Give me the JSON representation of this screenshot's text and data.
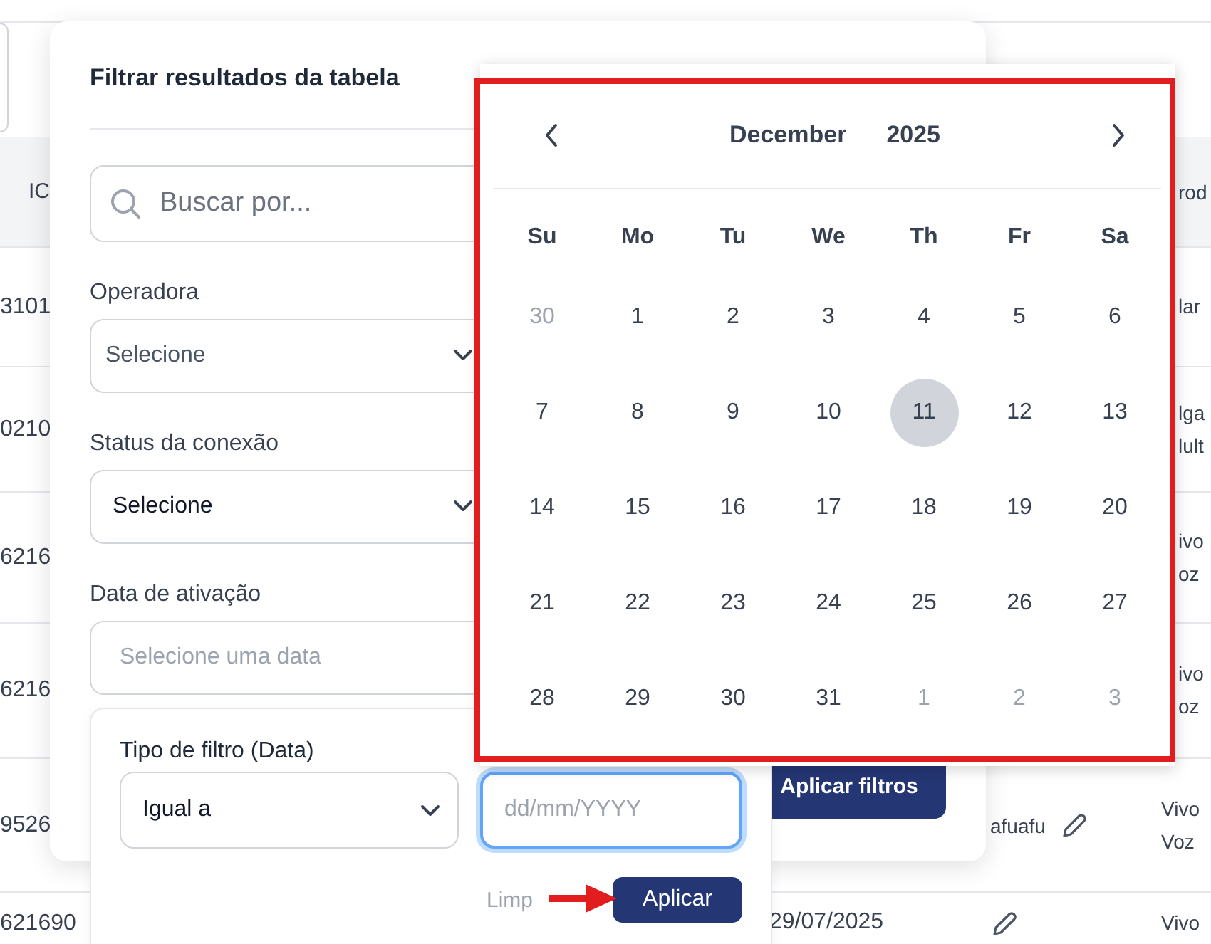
{
  "table": {
    "columns": [
      {
        "label": "IC"
      },
      {
        "label": "rod"
      }
    ],
    "rows": [
      {
        "id": "3101",
        "product": [
          "lar"
        ]
      },
      {
        "id": "0210",
        "product": [
          "lga",
          "lult"
        ]
      },
      {
        "id": "6216",
        "product": [
          "ivo",
          "oz"
        ]
      },
      {
        "id": "6216",
        "product": [
          "ivo",
          "oz"
        ]
      },
      {
        "id": "9526",
        "user": "afuafu",
        "editable": true,
        "product": [
          "Vivo",
          "Voz"
        ]
      },
      {
        "id": "621690",
        "date": "29/07/2025",
        "editable": true,
        "product": [
          "Vivo"
        ]
      }
    ]
  },
  "filter_panel": {
    "title": "Filtrar resultados da tabela",
    "search": {
      "placeholder": "Buscar por..."
    },
    "fields": [
      {
        "label": "Operadora",
        "kind": "select",
        "placeholder": "Selecione"
      },
      {
        "label": "Status da conexão",
        "kind": "select",
        "value": "Selecione"
      },
      {
        "label": "Data de ativação",
        "kind": "date",
        "placeholder": "Selecione uma data"
      }
    ],
    "apply_button": "Aplicar filtros"
  },
  "date_filter": {
    "label": "Tipo de filtro (Data)",
    "type_select": {
      "value": "Igual a"
    },
    "date_input": {
      "placeholder": "dd/mm/YYYY",
      "focused": true
    },
    "clear_link": "Limp",
    "apply_button": "Aplicar"
  },
  "calendar": {
    "month": "December",
    "year": "2025",
    "weekdays": [
      "Su",
      "Mo",
      "Tu",
      "We",
      "Th",
      "Fr",
      "Sa"
    ],
    "days": [
      {
        "label": "30",
        "outside": true,
        "selected": false
      },
      {
        "label": "1",
        "outside": false,
        "selected": false
      },
      {
        "label": "2",
        "outside": false,
        "selected": false
      },
      {
        "label": "3",
        "outside": false,
        "selected": false
      },
      {
        "label": "4",
        "outside": false,
        "selected": false
      },
      {
        "label": "5",
        "outside": false,
        "selected": false
      },
      {
        "label": "6",
        "outside": false,
        "selected": false
      },
      {
        "label": "7",
        "outside": false,
        "selected": false
      },
      {
        "label": "8",
        "outside": false,
        "selected": false
      },
      {
        "label": "9",
        "outside": false,
        "selected": false
      },
      {
        "label": "10",
        "outside": false,
        "selected": false
      },
      {
        "label": "11",
        "outside": false,
        "selected": true
      },
      {
        "label": "12",
        "outside": false,
        "selected": false
      },
      {
        "label": "13",
        "outside": false,
        "selected": false
      },
      {
        "label": "14",
        "outside": false,
        "selected": false
      },
      {
        "label": "15",
        "outside": false,
        "selected": false
      },
      {
        "label": "16",
        "outside": false,
        "selected": false
      },
      {
        "label": "17",
        "outside": false,
        "selected": false
      },
      {
        "label": "18",
        "outside": false,
        "selected": false
      },
      {
        "label": "19",
        "outside": false,
        "selected": false
      },
      {
        "label": "20",
        "outside": false,
        "selected": false
      },
      {
        "label": "21",
        "outside": false,
        "selected": false
      },
      {
        "label": "22",
        "outside": false,
        "selected": false
      },
      {
        "label": "23",
        "outside": false,
        "selected": false
      },
      {
        "label": "24",
        "outside": false,
        "selected": false
      },
      {
        "label": "25",
        "outside": false,
        "selected": false
      },
      {
        "label": "26",
        "outside": false,
        "selected": false
      },
      {
        "label": "27",
        "outside": false,
        "selected": false
      },
      {
        "label": "28",
        "outside": false,
        "selected": false
      },
      {
        "label": "29",
        "outside": false,
        "selected": false
      },
      {
        "label": "30",
        "outside": false,
        "selected": false
      },
      {
        "label": "31",
        "outside": false,
        "selected": false
      },
      {
        "label": "1",
        "outside": true,
        "selected": false
      },
      {
        "label": "2",
        "outside": true,
        "selected": false
      },
      {
        "label": "3",
        "outside": true,
        "selected": false
      }
    ]
  }
}
